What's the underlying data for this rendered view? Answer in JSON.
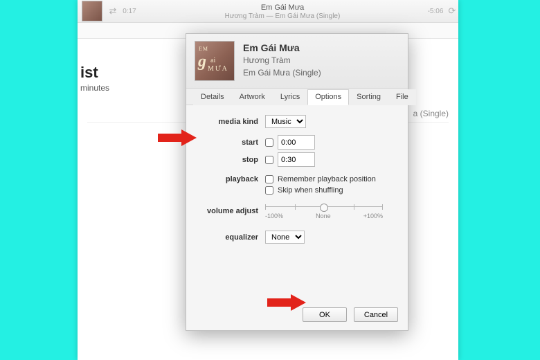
{
  "player": {
    "title": "Em Gái Mưa",
    "subtitle": "Hương Tràm — Em Gái Mưa (Single)",
    "elapsed": "0:17",
    "remaining": "-5:06"
  },
  "left_panel": {
    "heading_fragment": "ist",
    "sub_fragment": "minutes"
  },
  "back_list": {
    "title": "",
    "album_fragment": "a (Single)"
  },
  "dialog": {
    "title": "Em Gái Mưa",
    "artist": "Hương Tràm",
    "album": "Em Gái Mưa (Single)",
    "artwork_text": {
      "top": "EM",
      "big": "g",
      "ai": "ai",
      "mua": "MƯA"
    },
    "tabs": [
      "Details",
      "Artwork",
      "Lyrics",
      "Options",
      "Sorting",
      "File"
    ],
    "active_tab": "Options",
    "labels": {
      "media_kind": "media kind",
      "start": "start",
      "stop": "stop",
      "playback": "playback",
      "volume_adjust": "volume adjust",
      "equalizer": "equalizer"
    },
    "media_kind_value": "Music",
    "start_value": "0:00",
    "stop_value": "0:30",
    "start_checked": false,
    "stop_checked": false,
    "playback_remember": "Remember playback position",
    "playback_skip": "Skip when shuffling",
    "volume_labels": {
      "min": "-100%",
      "mid": "None",
      "max": "+100%"
    },
    "equalizer_value": "None",
    "ok": "OK",
    "cancel": "Cancel"
  }
}
